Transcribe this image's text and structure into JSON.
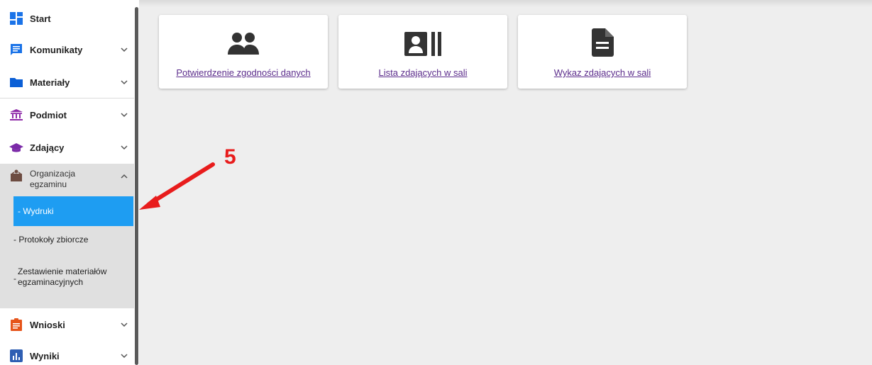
{
  "sidebar": {
    "items": [
      {
        "label": "Start",
        "icon": "dashboard-icon"
      },
      {
        "label": "Komunikaty",
        "icon": "message-icon"
      },
      {
        "label": "Materiały",
        "icon": "folder-icon"
      },
      {
        "label": "Podmiot",
        "icon": "institution-icon"
      },
      {
        "label": "Zdający",
        "icon": "graduation-cap-icon"
      },
      {
        "label": "Organizacja egzaminu",
        "label_line1": "Organizacja",
        "label_line2": "egzaminu",
        "icon": "box-icon"
      },
      {
        "label": "Wnioski",
        "icon": "clipboard-icon"
      },
      {
        "label": "Wyniki",
        "icon": "bar-chart-icon"
      }
    ],
    "subitems": [
      {
        "label": "- Wydruki",
        "active": true
      },
      {
        "label": "- Protokoły zbiorcze"
      },
      {
        "label": "Zestawienie materiałów egzaminacyjnych",
        "prefix": "-",
        "line1": "Zestawienie materiałów",
        "line2": "egzaminacyjnych"
      }
    ]
  },
  "cards": [
    {
      "label": "Potwierdzenie zgodności danych",
      "icon": "people-icon"
    },
    {
      "label": "Lista zdających w sali",
      "icon": "contact-list-icon"
    },
    {
      "label": "Wykaz zdających w sali",
      "icon": "document-icon"
    }
  ],
  "annotation": {
    "number": "5"
  },
  "colors": {
    "active": "#1e9df2",
    "link": "#5c2d8c",
    "annotation": "#e81c1c",
    "komunikaty": "#1a73e8",
    "materialy": "#0b5fd6",
    "podmiot": "#8e2aa8",
    "zdajacy": "#7b2aa8",
    "organizacja": "#6d4c41",
    "wnioski": "#e6541a",
    "wyniki": "#2f5fb3"
  }
}
